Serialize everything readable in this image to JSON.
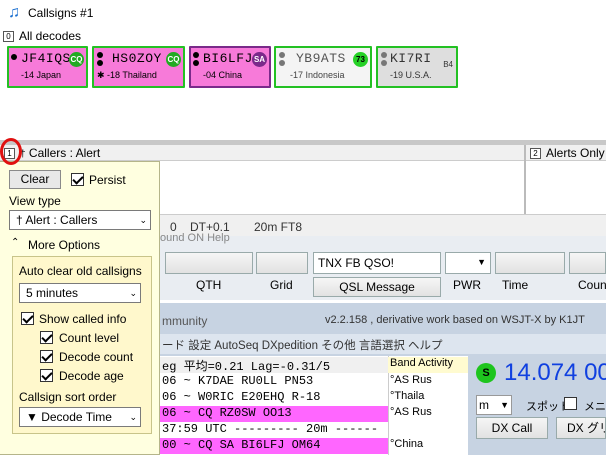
{
  "window": {
    "title": "Callsigns #1"
  },
  "all_decodes": {
    "index": "0",
    "label": "All decodes"
  },
  "cards": [
    {
      "call": "JF4IQS",
      "sub": "-14 Japan",
      "bg": "#f77ad9",
      "border": "#23c123",
      "badge": "CQ",
      "badge_color": "#22aa22",
      "tag": ""
    },
    {
      "call": "HS0ZOY",
      "sub": "✱ -18 Thailand",
      "bg": "#f77ad9",
      "border": "#23c123",
      "badge": "CQ",
      "badge_color": "#22aa22",
      "tag": ""
    },
    {
      "call": "BI6LFJ",
      "sub": "-04 China",
      "bg": "#f77ad9",
      "border": "#7a2a8a",
      "badge": "SA",
      "badge_color": "#7a2a8a",
      "tag": ""
    },
    {
      "call": "YB9ATS",
      "sub": "-17 Indonesia",
      "bg": "#f4f4f4",
      "border": "#23c123",
      "badge": "73",
      "badge_color": "#26d126",
      "tag": ""
    },
    {
      "call": "KI7RI",
      "sub": "-19 U.S.A.",
      "bg": "#dedede",
      "border": "#23c123",
      "badge": "",
      "badge_color": "",
      "tag": "B4"
    }
  ],
  "callers": {
    "index": "1",
    "label": "Callers : Alert"
  },
  "alerts": {
    "index": "2",
    "label": "Alerts Only"
  },
  "popup": {
    "clear_label": "Clear",
    "persist_label": "Persist",
    "view_type_label": "View type",
    "view_type_value": "† Alert : Callers",
    "more_options_label": "More Options",
    "auto_clear_label": "Auto clear old callsigns",
    "auto_clear_value": "5 minutes",
    "show_called_info_label": "Show called info",
    "count_level_label": "Count level",
    "decode_count_label": "Decode count",
    "decode_age_label": "Decode age",
    "sort_order_label": "Callsign sort order",
    "sort_order_value": "▼ Decode Time"
  },
  "background": {
    "status_count": "0",
    "dt": "DT+0.1",
    "band_mode": "20m FT8",
    "menu_fragment": "ound ON   Help",
    "tnx_msg": "TNX FB QSO!",
    "qth_label": "QTH",
    "grid_label": "Grid",
    "qsl_message_label": "QSL Message",
    "pwr_label": "PWR",
    "time_label": "Time",
    "count_label": "Coun",
    "community_label": "mmunity",
    "version_text": "v2.2.158 , derivative work based on WSJT-X by K1JT",
    "menu_bar2": "ード  設定  AutoSeq  DXpedition  その他  言語選択  ヘルプ",
    "stats_line": "eg  平均=0.21 Lag=-0.31/5",
    "band_activity_label": "Band Activity",
    "frequency": "14.074 00",
    "s_badge": "S",
    "spot_label": "スポット",
    "mode_short": "m",
    "menu_short": "メニ",
    "dx_call_label": "DX Call",
    "dx_grid_label": "DX グリ",
    "decodes": [
      {
        "text": "06 ~ K7DAE RU0LL PN53",
        "country": "°AS Rus",
        "bg": "#ffffff"
      },
      {
        "text": "06 ~ W0RIC E20EHQ R-18",
        "country": "°Thaila",
        "bg": "#ffffff"
      },
      {
        "text": "06 ~ CQ RZ0SW OO13",
        "country": "°AS Rus",
        "bg": "#ff66ff"
      },
      {
        "text": "37:59 UTC --------- 20m ------",
        "country": "",
        "bg": "#ffffff"
      },
      {
        "text": "00 ~ CQ SA BI6LFJ OM64",
        "country": "°China",
        "bg": "#ff66ff"
      }
    ]
  }
}
